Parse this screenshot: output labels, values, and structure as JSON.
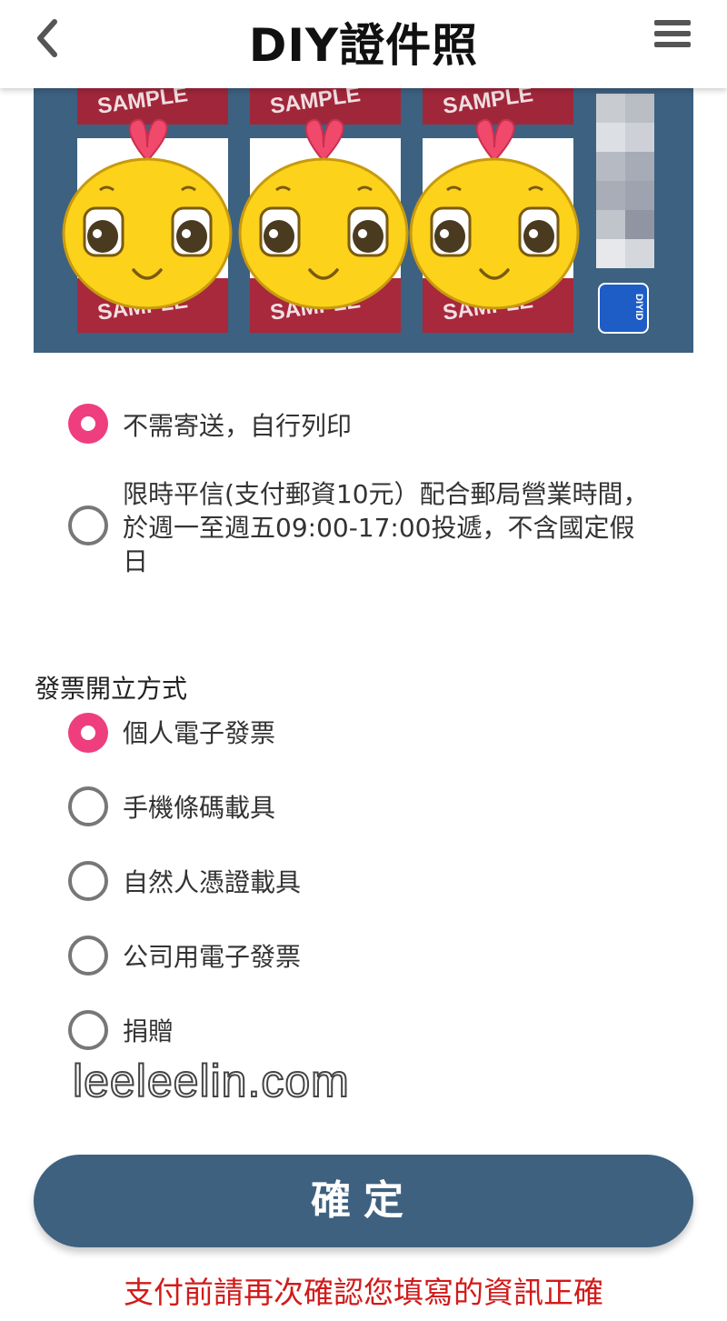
{
  "header": {
    "title": "DIY證件照",
    "back_icon": "chevron-left-icon",
    "menu_icon": "hamburger-menu-icon"
  },
  "preview": {
    "sample_label": "SAMPLE",
    "logo_label": "DIYID"
  },
  "shipping": {
    "options": [
      {
        "label": "不需寄送，自行列印",
        "checked": true
      },
      {
        "label": "限時平信(支付郵資10元）配合郵局營業時間，於週一至週五09:00-17:00投遞，不含國定假日",
        "checked": false
      }
    ]
  },
  "invoice": {
    "title": "發票開立方式",
    "options": [
      {
        "label": "個人電子發票",
        "checked": true
      },
      {
        "label": "手機條碼載具",
        "checked": false
      },
      {
        "label": "自然人憑證載具",
        "checked": false
      },
      {
        "label": "公司用電子發票",
        "checked": false
      },
      {
        "label": "捐贈",
        "checked": false
      }
    ]
  },
  "watermark": "leeleelin.com",
  "confirm_label": "確定",
  "warning": "支付前請再次確認您填寫的資訊正確",
  "colors": {
    "accent_pink": "#ee3e7e",
    "primary_blue": "#3f6180",
    "warning_red": "#d21a1a"
  }
}
